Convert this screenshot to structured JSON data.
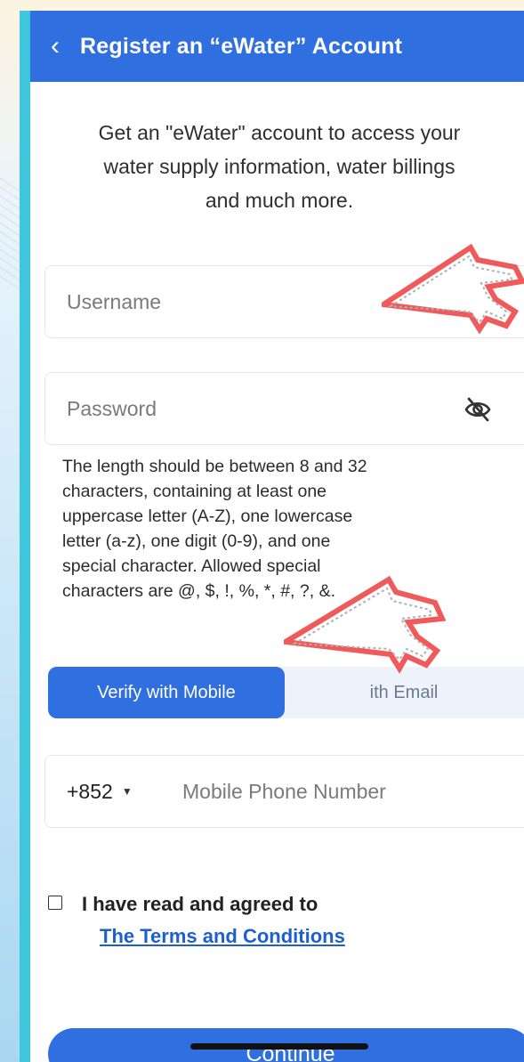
{
  "header": {
    "back_icon": "chevron-left-icon",
    "back_glyph": "‹",
    "title": "Register an “eWater” Account"
  },
  "intro": {
    "line1": "Get an \"eWater\" account to access your",
    "line2": "water supply information, water billings",
    "line3": "and much more."
  },
  "form": {
    "username_placeholder": "Username",
    "username_value": "",
    "password_placeholder": "Password",
    "password_value": "",
    "password_toggle_icon": "eye-off-icon",
    "password_hint": [
      "The length should be between 8 and 32",
      "characters, containing at least one",
      "uppercase letter (A-Z), one lowercase",
      "letter (a-z), one digit (0-9), and one",
      "special character. Allowed special",
      "characters are @, $, !, %, *, #, ?, &."
    ],
    "tab_mobile": "Verify with Mobile",
    "tab_email": "ith Email",
    "country_code": "+852",
    "country_code_caret": "▼",
    "phone_placeholder": "Mobile Phone Number",
    "phone_value": ""
  },
  "agreement": {
    "checked": false,
    "text": "I have read and agreed to",
    "link": "The Terms and Conditions"
  },
  "actions": {
    "continue_label": "Continue"
  },
  "annotations": {
    "arrow_icon": "pixel-pointer-arrow-icon",
    "arrow_color": "#f05a5a"
  },
  "colors": {
    "primary": "#2f6fe0",
    "frame": "#3fc6dd",
    "link": "#1e5fd0"
  }
}
